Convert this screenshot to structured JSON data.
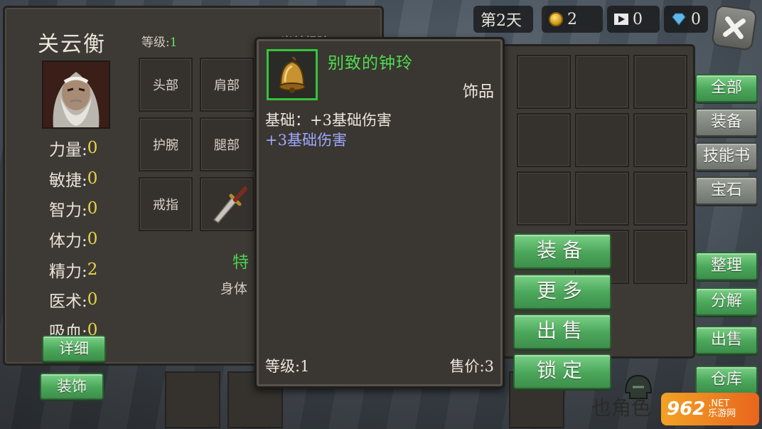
{
  "character": {
    "name": "关云衡",
    "level_label": "等级:",
    "level_value": "1",
    "exp_label": "当前经验:2/75",
    "stats": [
      {
        "label": "力量:",
        "value": "0"
      },
      {
        "label": "敏捷:",
        "value": "0"
      },
      {
        "label": "智力:",
        "value": "0"
      },
      {
        "label": "体力:",
        "value": "0"
      },
      {
        "label": "精力:",
        "value": "2"
      },
      {
        "label": "医术:",
        "value": "0"
      },
      {
        "label": "吸血:",
        "value": "0"
      }
    ],
    "detail_button": "详细",
    "accessory_button": "装饰"
  },
  "equip_slots": {
    "head": "头部",
    "shoulder": "肩部",
    "wrist": "护腕",
    "leg": "腿部",
    "ring": "戒指"
  },
  "special_label": "特",
  "body_label": "身体",
  "topbar": {
    "day": "第2天",
    "coins": "2",
    "videos": "0",
    "gems": "0"
  },
  "tabs": [
    "全部",
    "装备",
    "技能书",
    "宝石"
  ],
  "side_actions": [
    "整理",
    "分解",
    "出售",
    "仓库"
  ],
  "tooltip": {
    "name": "别致的钟玲",
    "type": "饰品",
    "base": "基础：+3基础伤害",
    "bonus": "+3基础伤害",
    "level": "等级:1",
    "price": "售价:3"
  },
  "item_actions": [
    "装备",
    "更多",
    "出售",
    "锁定"
  ],
  "map_text": "也角色",
  "watermark": {
    "big": "962",
    "dot": ".NET",
    "small": "乐游网"
  },
  "colors": {
    "panel": "#3d3a35",
    "button_green": "#4aa65a",
    "item_name": "#4fdc4f",
    "bonus_text": "#9ea8ff",
    "stat_value": "#e7d44a"
  },
  "icons": [
    "coin-icon",
    "video-icon",
    "diamond-icon",
    "close-icon",
    "bell-icon",
    "dagger-icon",
    "helmet-icon"
  ]
}
